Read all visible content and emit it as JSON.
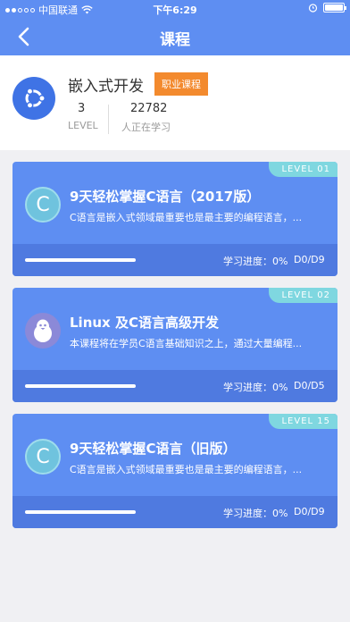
{
  "status_bar": {
    "carrier": "中国联通",
    "time": "下午6:29"
  },
  "navbar": {
    "title": "课程"
  },
  "header": {
    "course_title": "嵌入式开发",
    "badge": "职业课程",
    "level_value": "3",
    "level_label": "LEVEL",
    "learning_value": "22782",
    "learning_label": "人正在学习"
  },
  "cards": [
    {
      "level_tag": "LEVEL  01",
      "icon": "c-language-icon",
      "icon_glyph": "C",
      "title": "9天轻松掌握C语言（2017版）",
      "desc": "C语言是嵌入式领域最重要也是最主要的编程语言，...",
      "progress_label": "学习进度：0%",
      "progress_fraction": 0,
      "count": "D0/D9"
    },
    {
      "level_tag": "LEVEL  02",
      "icon": "linux-icon",
      "icon_glyph": "",
      "title": "Linux 及C语言高级开发",
      "desc": "本课程将在学员C语言基础知识之上，通过大量编程...",
      "progress_label": "学习进度：0%",
      "progress_fraction": 0,
      "count": "D0/D5"
    },
    {
      "level_tag": "LEVEL  15",
      "icon": "c-language-icon",
      "icon_glyph": "C",
      "title": "9天轻松掌握C语言（旧版）",
      "desc": "C语言是嵌入式领域最重要也是最主要的编程语言，...",
      "progress_label": "学习进度：0%",
      "progress_fraction": 0,
      "count": "D0/D9"
    }
  ],
  "colors": {
    "primary": "#5e8ef2",
    "card_footer": "#4f7ae0",
    "badge": "#f38a2e",
    "level_tag": "#7fd7e0"
  }
}
